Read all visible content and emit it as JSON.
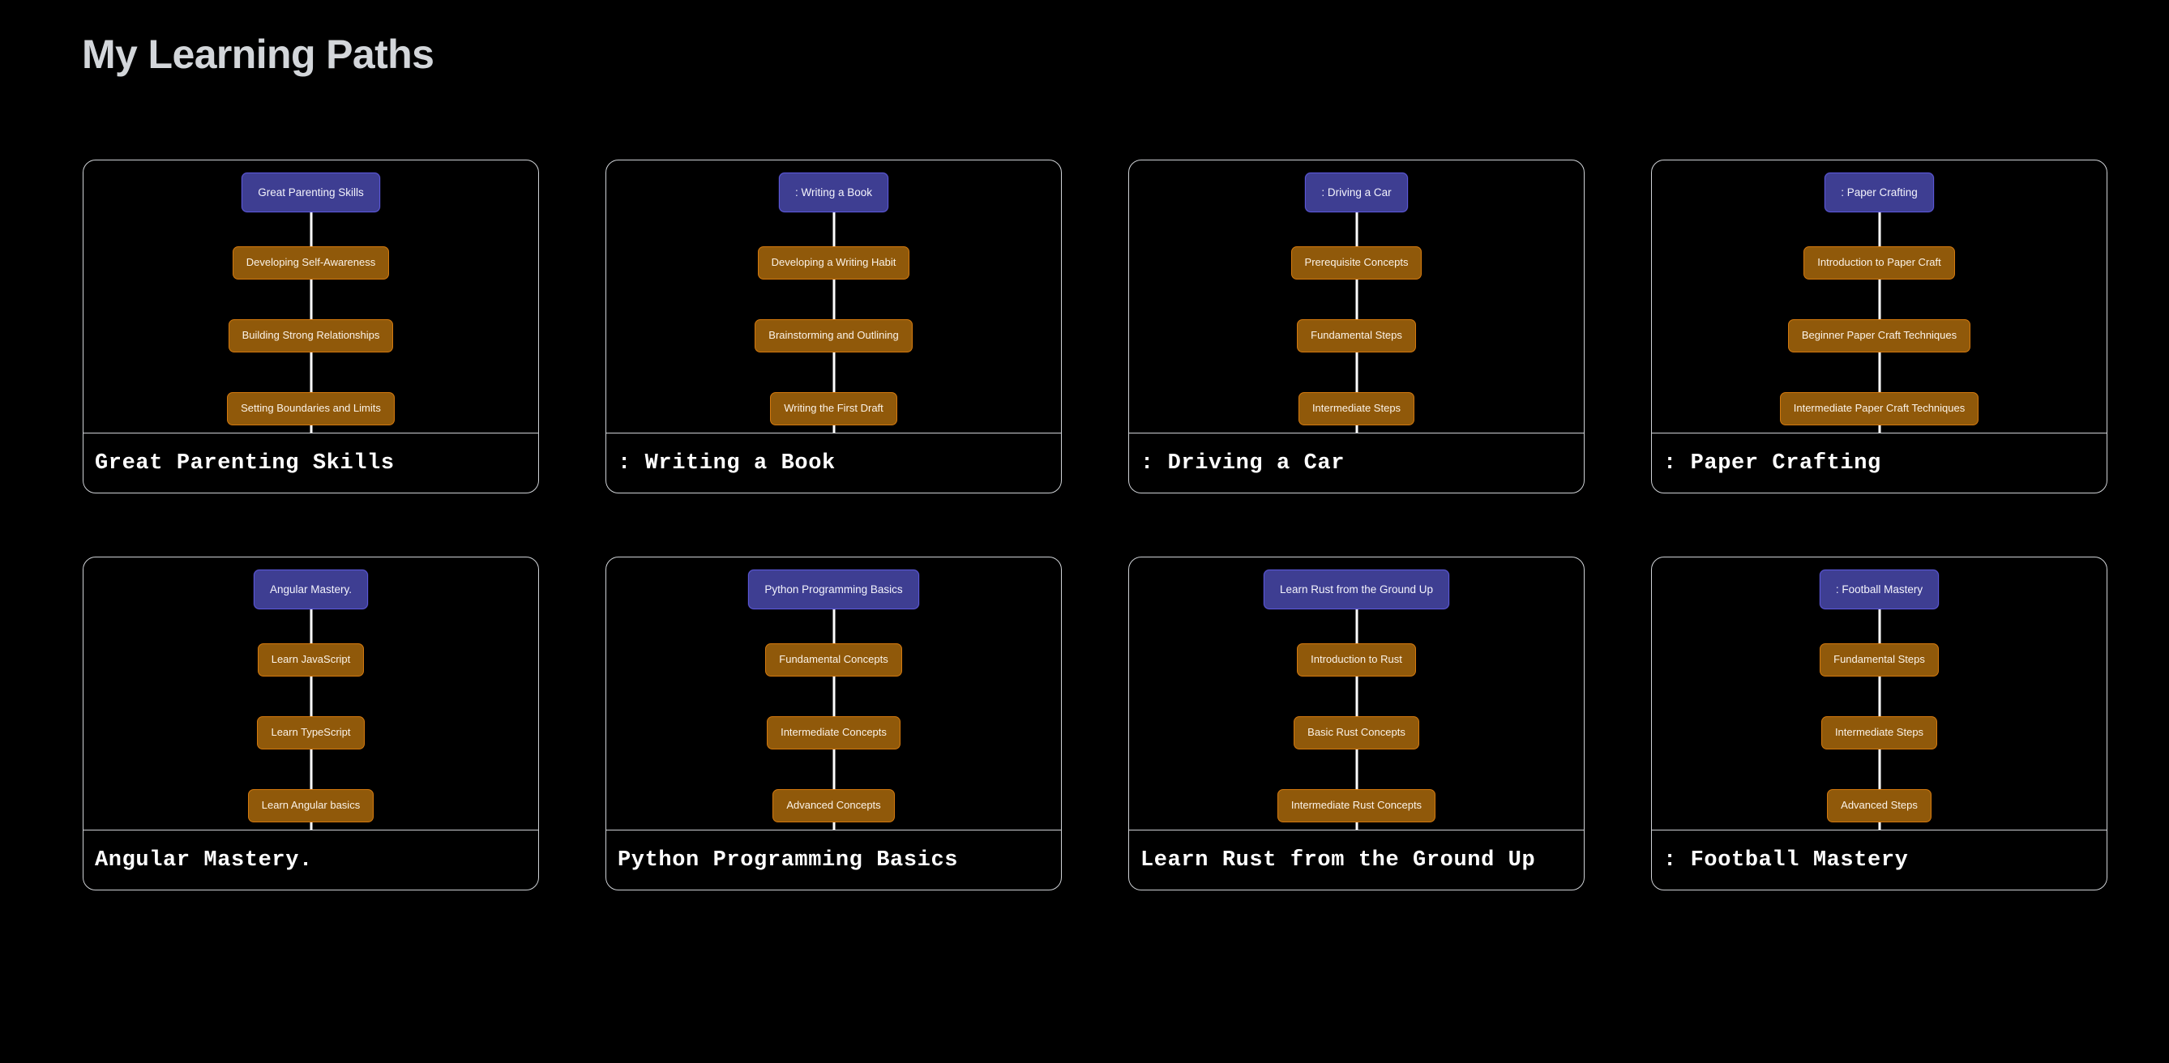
{
  "header": {
    "title": "My Learning Paths"
  },
  "theme": {
    "background": "#000000",
    "title_color": "#d3d6da",
    "card_border": "#cfd2d6",
    "root_node_fill": "#3e3e92",
    "root_node_border": "#5b57d8",
    "root_node_text": "#f3f3fb",
    "step_node_fill": "#90590a",
    "step_node_border": "#d4790e",
    "step_node_text": "#fbf3e8",
    "connector_line": "#ffffff",
    "caption_color": "#ffffff"
  },
  "cards": [
    {
      "caption": "Great Parenting Skills",
      "root": "Great Parenting Skills",
      "steps": [
        "Developing Self-Awareness",
        "Building Strong Relationships",
        "Setting Boundaries and Limits"
      ]
    },
    {
      "caption": ": Writing a Book",
      "root": ": Writing a Book",
      "steps": [
        "Developing a Writing Habit",
        "Brainstorming and Outlining",
        "Writing the First Draft"
      ]
    },
    {
      "caption": ": Driving a Car",
      "root": ": Driving a Car",
      "steps": [
        "Prerequisite Concepts",
        "Fundamental Steps",
        "Intermediate Steps"
      ]
    },
    {
      "caption": ": Paper Crafting",
      "root": ": Paper Crafting",
      "steps": [
        "Introduction to Paper Craft",
        "Beginner Paper Craft Techniques",
        "Intermediate Paper Craft Techniques"
      ]
    },
    {
      "caption": "Angular Mastery.",
      "root": "Angular Mastery.",
      "steps": [
        "Learn JavaScript",
        "Learn TypeScript",
        "Learn Angular basics"
      ]
    },
    {
      "caption": "Python Programming Basics",
      "root": "Python Programming Basics",
      "steps": [
        "Fundamental Concepts",
        "Intermediate Concepts",
        "Advanced Concepts"
      ]
    },
    {
      "caption": "Learn Rust from the Ground Up",
      "root": "Learn Rust from the Ground Up",
      "steps": [
        "Introduction to Rust",
        "Basic Rust Concepts",
        "Intermediate Rust Concepts"
      ]
    },
    {
      "caption": ": Football Mastery",
      "root": ": Football Mastery",
      "steps": [
        "Fundamental Steps",
        "Intermediate Steps",
        "Advanced Steps"
      ]
    }
  ]
}
